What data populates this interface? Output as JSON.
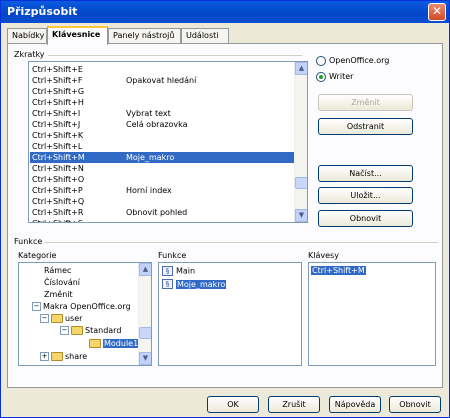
{
  "window": {
    "title": "Přizpůsobit",
    "close_glyph": "✕"
  },
  "tabs": [
    {
      "label": "Nabídky"
    },
    {
      "label": "Klávesnice"
    },
    {
      "label": "Panely nástrojů"
    },
    {
      "label": "Události"
    }
  ],
  "shortcuts": {
    "label": "Zkratky",
    "rows": [
      {
        "key": "Ctrl+Shift+E",
        "fn": ""
      },
      {
        "key": "Ctrl+Shift+F",
        "fn": "Opakovat hledání"
      },
      {
        "key": "Ctrl+Shift+G",
        "fn": ""
      },
      {
        "key": "Ctrl+Shift+H",
        "fn": ""
      },
      {
        "key": "Ctrl+Shift+I",
        "fn": "Vybrat text"
      },
      {
        "key": "Ctrl+Shift+J",
        "fn": "Celá obrazovka"
      },
      {
        "key": "Ctrl+Shift+K",
        "fn": ""
      },
      {
        "key": "Ctrl+Shift+L",
        "fn": ""
      },
      {
        "key": "Ctrl+Shift+M",
        "fn": "Moje_makro"
      },
      {
        "key": "Ctrl+Shift+N",
        "fn": ""
      },
      {
        "key": "Ctrl+Shift+O",
        "fn": ""
      },
      {
        "key": "Ctrl+Shift+P",
        "fn": "Horní index"
      },
      {
        "key": "Ctrl+Shift+Q",
        "fn": ""
      },
      {
        "key": "Ctrl+Shift+R",
        "fn": "Obnovit pohled"
      },
      {
        "key": "Ctrl+Shift+S",
        "fn": ""
      }
    ],
    "selected_index": 8
  },
  "scope": {
    "options": [
      {
        "label": "OpenOffice.org"
      },
      {
        "label": "Writer"
      }
    ],
    "selected": "Writer"
  },
  "side_buttons": {
    "modify": "Změnit",
    "delete": "Odstranit",
    "load": "Načíst...",
    "save": "Uložit...",
    "reset": "Obnovit"
  },
  "functions": {
    "label": "Funkce",
    "category_label": "Kategorie",
    "function_label": "Funkce",
    "keys_label": "Klávesy",
    "categories": [
      {
        "label": "Rámec"
      },
      {
        "label": "Číslování"
      },
      {
        "label": "Změnit"
      },
      {
        "label": "Makra OpenOffice.org"
      },
      {
        "label": "user"
      },
      {
        "label": "Standard"
      },
      {
        "label": "Module1"
      },
      {
        "label": "share"
      }
    ],
    "function_items": [
      {
        "label": "Main"
      },
      {
        "label": "Moje_makro"
      }
    ],
    "key_items": [
      {
        "label": "Ctrl+Shift+M"
      }
    ]
  },
  "footer": {
    "ok": "OK",
    "cancel": "Zrušit",
    "help": "Nápověda",
    "reset": "Obnovit"
  },
  "colors": {
    "selection": "#316ac5",
    "titlebar": "#0a4fd0",
    "dialog_bg": "#ece9d8"
  }
}
